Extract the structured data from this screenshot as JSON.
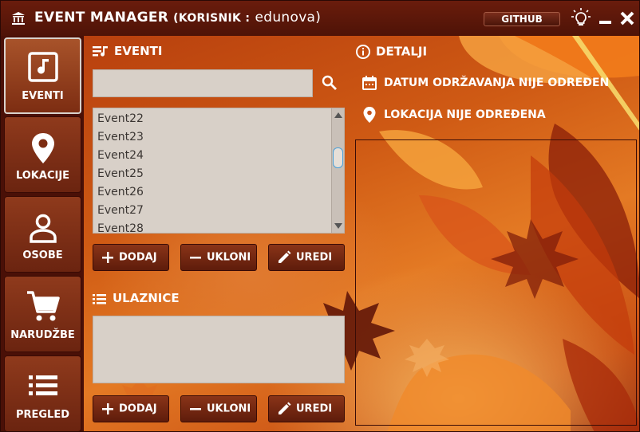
{
  "window": {
    "title": "EVENT MANAGER",
    "user_label": "(KORISNIK :",
    "user_name": "edunova)",
    "github_label": "GITHUB",
    "icons": [
      "bank-icon",
      "lightbulb-icon",
      "minimize-icon",
      "close-icon"
    ]
  },
  "sidebar": {
    "items": [
      {
        "label": "EVENTI",
        "icon": "music-note-icon",
        "active": true
      },
      {
        "label": "LOKACIJE",
        "icon": "location-pin-icon",
        "active": false
      },
      {
        "label": "OSOBE",
        "icon": "person-icon",
        "active": false
      },
      {
        "label": "NARUDŽBE",
        "icon": "shopping-cart-icon",
        "active": false
      },
      {
        "label": "PREGLED",
        "icon": "list-icon",
        "active": false
      }
    ]
  },
  "events": {
    "heading": "EVENTI",
    "search_value": "",
    "items": [
      "Event22",
      "Event23",
      "Event24",
      "Event25",
      "Event26",
      "Event27",
      "Event28"
    ],
    "scroll_position": 0.35,
    "buttons": {
      "add": "DODAJ",
      "remove": "UKLONI",
      "edit": "UREDI"
    }
  },
  "tickets": {
    "heading": "ULAZNICE",
    "buttons": {
      "add": "DODAJ",
      "remove": "UKLONI",
      "edit": "UREDI"
    }
  },
  "details": {
    "heading": "DETALJI",
    "date_text": "DATUM ODRŽAVANJA NIJE ODREĐEN",
    "location_text": "LOKACIJA NIJE ODREĐENA"
  },
  "colors": {
    "accent": "#e47a24",
    "sidebar_bg": "#4a1007",
    "button_bg": "#6e2410",
    "input_bg": "#d8d0c8"
  }
}
